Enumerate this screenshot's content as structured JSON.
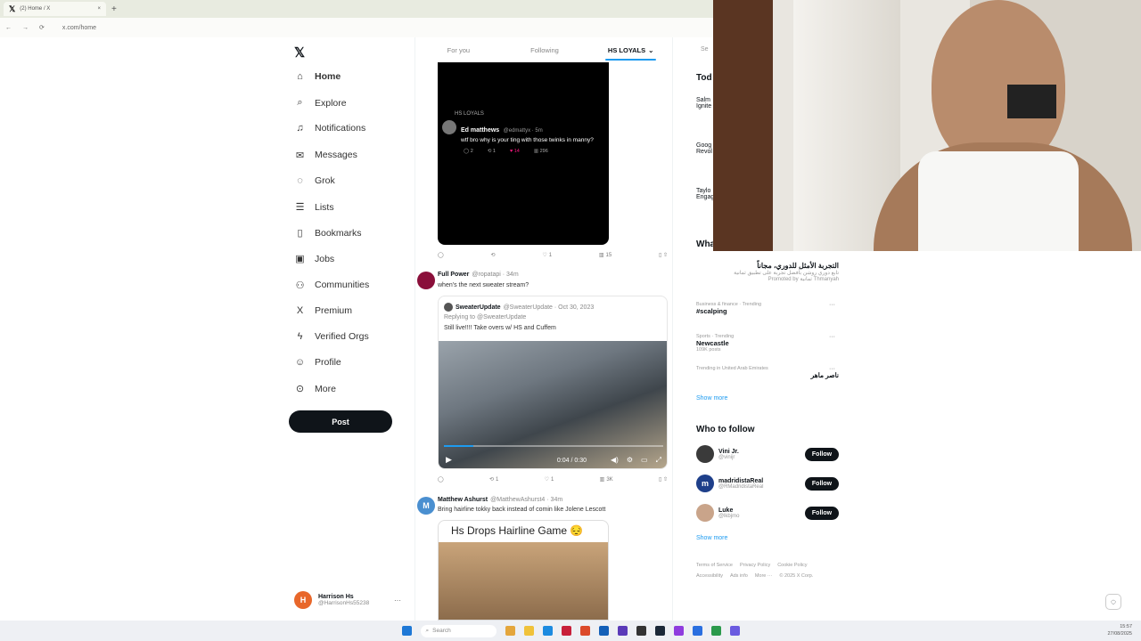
{
  "browser": {
    "tab_title": "(2) Home / X",
    "new_tab": "+",
    "url": "x.com/home",
    "back": "←",
    "forward": "→",
    "reload": "⟳"
  },
  "sidebar": {
    "items": [
      {
        "label": "Home",
        "icon": "home-icon",
        "glyph": "⌂"
      },
      {
        "label": "Explore",
        "icon": "search-icon",
        "glyph": "⌕"
      },
      {
        "label": "Notifications",
        "icon": "bell-icon",
        "glyph": "♫"
      },
      {
        "label": "Messages",
        "icon": "mail-icon",
        "glyph": "✉"
      },
      {
        "label": "Grok",
        "icon": "grok-icon",
        "glyph": "◌"
      },
      {
        "label": "Lists",
        "icon": "list-icon",
        "glyph": "☰"
      },
      {
        "label": "Bookmarks",
        "icon": "bookmark-icon",
        "glyph": "▯"
      },
      {
        "label": "Jobs",
        "icon": "briefcase-icon",
        "glyph": "▣"
      },
      {
        "label": "Communities",
        "icon": "people-icon",
        "glyph": "⚇"
      },
      {
        "label": "Premium",
        "icon": "x-icon",
        "glyph": "X"
      },
      {
        "label": "Verified Orgs",
        "icon": "lightning-icon",
        "glyph": "ϟ"
      },
      {
        "label": "Profile",
        "icon": "person-icon",
        "glyph": "☺"
      },
      {
        "label": "More",
        "icon": "more-circle-icon",
        "glyph": "⊙"
      }
    ],
    "post_button": "Post",
    "account": {
      "name": "Harrison Hs",
      "handle": "@HarrisonHs55238",
      "initial": "H",
      "more": "···"
    }
  },
  "feed": {
    "tabs": [
      "For you",
      "Following",
      "HS LOYALS"
    ],
    "tab_chevron": "⌄",
    "post1": {
      "quote": {
        "community": "HS LOYALS",
        "name": "Ed matthews",
        "handle": "@edmattyx · 5m",
        "text": "wtf bro why is your ting with those twinks in manny?",
        "stats": [
          "2",
          "1",
          "14",
          "296"
        ]
      },
      "stats": [
        "",
        "",
        "1",
        "15"
      ]
    },
    "post2": {
      "name": "Full Power",
      "handle": "@ropatapi · 34m",
      "text": "when's the next sweater stream?",
      "quote": {
        "name": "SweaterUpdate",
        "handle": "@SweaterUpdate · Oct 30, 2023",
        "reply": "Replying to @SweaterUpdate",
        "text": "Still live!!!! Take overs w/ HS and Cuffem"
      },
      "video_time": "0:04 / 0:30",
      "stats": [
        "",
        "1",
        "1",
        "3K"
      ]
    },
    "post3": {
      "name": "Matthew Ashurst",
      "handle": "@MatthewAshurst4 · 34m",
      "text": "Bring hairline tokky back instead of comin like Jolene Lescott",
      "initial": "M",
      "image_caption": "Hs Drops Hairline Game 😔"
    }
  },
  "right": {
    "search_placeholder": "Se",
    "today_heading": "Tod",
    "whats_heading": "Wha",
    "trends_partial": [
      {
        "line1": "Salm",
        "line2": "Ignite"
      },
      {
        "line1": "Goog",
        "line2": "Revol"
      },
      {
        "line1": "Taylo",
        "line2": "Engag"
      }
    ],
    "promo": {
      "title": "التجربة الأمثل للدوري، مجاناً",
      "desc": "تابع دوري روشن بأفضل تجربة على تطبيق ثمانية",
      "promoted": "Promoted by ثمانية Thmanyah"
    },
    "trends": [
      {
        "category": "Business & finance · Trending",
        "title": "#scalping",
        "posts": ""
      },
      {
        "category": "Sports · Trending",
        "title": "Newcastle",
        "posts": "109K posts"
      },
      {
        "category": "Trending in United Arab Emirates",
        "title": "ناصر ماهر",
        "posts": ""
      }
    ],
    "show_more": "Show more",
    "who_to_follow": "Who to follow",
    "follow": [
      {
        "name": "Vini Jr.",
        "handle": "@vinijr",
        "avatar_color": "#3a3a3a"
      },
      {
        "name": "madridistaReal",
        "handle": "@RMadridistaReal",
        "avatar_color": "#1e3f8a",
        "initial": "m"
      },
      {
        "name": "Luke",
        "handle": "@lkbjmo",
        "avatar_color": "#c9a48a"
      }
    ],
    "follow_label": "Follow",
    "footer": [
      "Terms of Service",
      "Privacy Policy",
      "Cookie Policy",
      "Accessibility",
      "Ads info",
      "More ···",
      "© 2025 X Corp."
    ]
  },
  "taskbar": {
    "search": "Search",
    "clock": "15:57",
    "date": "27/08/2025"
  },
  "colors": {
    "accent": "#1d9bf0",
    "like": "#f91880",
    "dark": "#0f1419"
  }
}
